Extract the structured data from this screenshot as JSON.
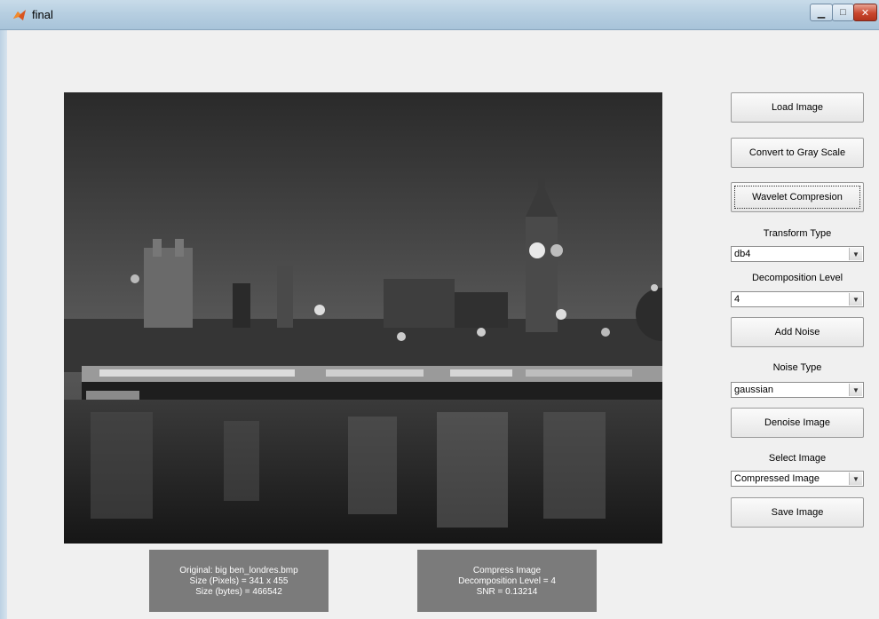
{
  "window": {
    "title": "final",
    "min_glyph": "▁",
    "max_glyph": "□",
    "close_glyph": "✕"
  },
  "image": {
    "description_icon": "grayscale-photo"
  },
  "info_original": {
    "line1": "Original:  big ben_londres.bmp",
    "line2": "Size (Pixels) = 341 x 455",
    "line3": "Size (bytes) = 466542"
  },
  "info_compress": {
    "line1": "Compress Image",
    "line2": "Decomposition Level = 4",
    "line3": "SNR =  0.13214"
  },
  "controls": {
    "load_image": "Load Image",
    "convert_gray": "Convert to Gray Scale",
    "wavelet_compression": "Wavelet Compresion",
    "transform_type_label": "Transform Type",
    "transform_type_value": "db4",
    "decomposition_level_label": "Decomposition Level",
    "decomposition_level_value": "4",
    "add_noise": "Add Noise",
    "noise_type_label": "Noise Type",
    "noise_type_value": "gaussian",
    "denoise_image": "Denoise Image",
    "select_image_label": "Select Image",
    "select_image_value": "Compressed Image",
    "save_image": "Save Image",
    "dropdown_arrow": "▼"
  },
  "colors": {
    "titlebar": "#b7cfe1",
    "close_button": "#c9462d",
    "info_box": "#7b7b7b"
  }
}
